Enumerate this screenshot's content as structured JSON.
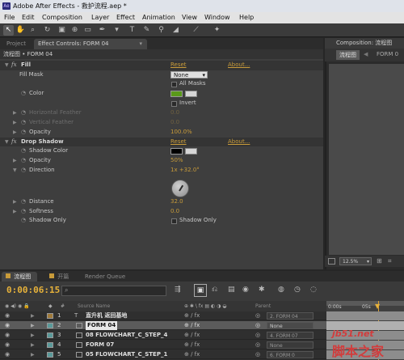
{
  "window": {
    "title": "Adobe After Effects - 救护流程.aep *"
  },
  "menu": [
    "File",
    "Edit",
    "Composition",
    "Layer",
    "Effect",
    "Animation",
    "View",
    "Window",
    "Help"
  ],
  "tabs": {
    "project": "Project",
    "effect_controls": "Effect Controls: FORM 04"
  },
  "effect_controls": {
    "header": "流程图 • FORM 04",
    "rows": [
      {
        "label": "Fill",
        "value": "Reset",
        "extra": "About...",
        "kind": "effect"
      },
      {
        "label": "Fill Mask",
        "value": "None",
        "kind": "dropdown"
      },
      {
        "label": "All Masks",
        "kind": "checkbox"
      },
      {
        "label": "Color",
        "kind": "color",
        "color": "#5a9a1a"
      },
      {
        "label": "Invert",
        "kind": "checkbox"
      },
      {
        "label": "Horizontal Feather",
        "value": "0.0",
        "kind": "dimprop"
      },
      {
        "label": "Vertical Feather",
        "value": "0.0",
        "kind": "dimprop"
      },
      {
        "label": "Opacity",
        "value": "100.0%",
        "kind": "prop"
      },
      {
        "label": "Drop Shadow",
        "value": "Reset",
        "extra": "About...",
        "kind": "effect"
      },
      {
        "label": "Shadow Color",
        "kind": "color",
        "color": "#000000"
      },
      {
        "label": "Opacity",
        "value": "50%",
        "kind": "prop"
      },
      {
        "label": "Direction",
        "value": "1x +32.0°",
        "kind": "prop"
      },
      {
        "label": "Distance",
        "value": "32.0",
        "kind": "prop"
      },
      {
        "label": "Softness",
        "value": "0.0",
        "kind": "prop"
      },
      {
        "label": "Shadow Only",
        "check_label": "Shadow Only",
        "kind": "checkprop"
      }
    ]
  },
  "composition": {
    "tab": "Composition: 流程图",
    "sub_tab": "流程图",
    "sub_tab2": "FORM 0",
    "zoom": "12.5%"
  },
  "timeline": {
    "tabs": [
      "流程图",
      "开篇",
      "Render Queue"
    ],
    "timecode": "0:00:06:15",
    "search_placeholder": "",
    "col_source": "Source Name",
    "col_parent": "Parent",
    "ruler": [
      "0:00s",
      "05s"
    ],
    "layers": [
      {
        "num": "1",
        "name": "直升机 返回基地",
        "parent": "2. FORM 04",
        "color": "#a07a3a"
      },
      {
        "num": "2",
        "name": "FORM 04",
        "parent": "None",
        "color": "#5a9a9a",
        "selected": true
      },
      {
        "num": "3",
        "name": "08 FLOWCHART_C_STEP_4",
        "parent": "4. FORM 07",
        "color": "#5a9a9a"
      },
      {
        "num": "4",
        "name": "FORM 07",
        "parent": "None",
        "color": "#5a9a9a"
      },
      {
        "num": "5",
        "name": "05 FLOWCHART_C_STEP_1",
        "parent": "6. FORM 0",
        "color": "#5a9a9a"
      }
    ]
  },
  "watermark": {
    "site": "jb51.net",
    "brand": "脚本之家"
  }
}
